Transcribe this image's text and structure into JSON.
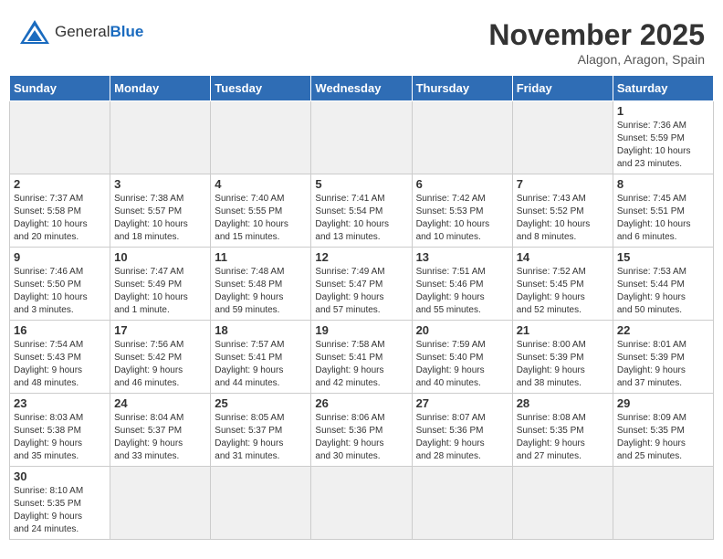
{
  "header": {
    "logo_general": "General",
    "logo_blue": "Blue",
    "month_title": "November 2025",
    "location": "Alagon, Aragon, Spain"
  },
  "weekdays": [
    "Sunday",
    "Monday",
    "Tuesday",
    "Wednesday",
    "Thursday",
    "Friday",
    "Saturday"
  ],
  "weeks": [
    [
      {
        "day": "",
        "info": ""
      },
      {
        "day": "",
        "info": ""
      },
      {
        "day": "",
        "info": ""
      },
      {
        "day": "",
        "info": ""
      },
      {
        "day": "",
        "info": ""
      },
      {
        "day": "",
        "info": ""
      },
      {
        "day": "1",
        "info": "Sunrise: 7:36 AM\nSunset: 5:59 PM\nDaylight: 10 hours\nand 23 minutes."
      }
    ],
    [
      {
        "day": "2",
        "info": "Sunrise: 7:37 AM\nSunset: 5:58 PM\nDaylight: 10 hours\nand 20 minutes."
      },
      {
        "day": "3",
        "info": "Sunrise: 7:38 AM\nSunset: 5:57 PM\nDaylight: 10 hours\nand 18 minutes."
      },
      {
        "day": "4",
        "info": "Sunrise: 7:40 AM\nSunset: 5:55 PM\nDaylight: 10 hours\nand 15 minutes."
      },
      {
        "day": "5",
        "info": "Sunrise: 7:41 AM\nSunset: 5:54 PM\nDaylight: 10 hours\nand 13 minutes."
      },
      {
        "day": "6",
        "info": "Sunrise: 7:42 AM\nSunset: 5:53 PM\nDaylight: 10 hours\nand 10 minutes."
      },
      {
        "day": "7",
        "info": "Sunrise: 7:43 AM\nSunset: 5:52 PM\nDaylight: 10 hours\nand 8 minutes."
      },
      {
        "day": "8",
        "info": "Sunrise: 7:45 AM\nSunset: 5:51 PM\nDaylight: 10 hours\nand 6 minutes."
      }
    ],
    [
      {
        "day": "9",
        "info": "Sunrise: 7:46 AM\nSunset: 5:50 PM\nDaylight: 10 hours\nand 3 minutes."
      },
      {
        "day": "10",
        "info": "Sunrise: 7:47 AM\nSunset: 5:49 PM\nDaylight: 10 hours\nand 1 minute."
      },
      {
        "day": "11",
        "info": "Sunrise: 7:48 AM\nSunset: 5:48 PM\nDaylight: 9 hours\nand 59 minutes."
      },
      {
        "day": "12",
        "info": "Sunrise: 7:49 AM\nSunset: 5:47 PM\nDaylight: 9 hours\nand 57 minutes."
      },
      {
        "day": "13",
        "info": "Sunrise: 7:51 AM\nSunset: 5:46 PM\nDaylight: 9 hours\nand 55 minutes."
      },
      {
        "day": "14",
        "info": "Sunrise: 7:52 AM\nSunset: 5:45 PM\nDaylight: 9 hours\nand 52 minutes."
      },
      {
        "day": "15",
        "info": "Sunrise: 7:53 AM\nSunset: 5:44 PM\nDaylight: 9 hours\nand 50 minutes."
      }
    ],
    [
      {
        "day": "16",
        "info": "Sunrise: 7:54 AM\nSunset: 5:43 PM\nDaylight: 9 hours\nand 48 minutes."
      },
      {
        "day": "17",
        "info": "Sunrise: 7:56 AM\nSunset: 5:42 PM\nDaylight: 9 hours\nand 46 minutes."
      },
      {
        "day": "18",
        "info": "Sunrise: 7:57 AM\nSunset: 5:41 PM\nDaylight: 9 hours\nand 44 minutes."
      },
      {
        "day": "19",
        "info": "Sunrise: 7:58 AM\nSunset: 5:41 PM\nDaylight: 9 hours\nand 42 minutes."
      },
      {
        "day": "20",
        "info": "Sunrise: 7:59 AM\nSunset: 5:40 PM\nDaylight: 9 hours\nand 40 minutes."
      },
      {
        "day": "21",
        "info": "Sunrise: 8:00 AM\nSunset: 5:39 PM\nDaylight: 9 hours\nand 38 minutes."
      },
      {
        "day": "22",
        "info": "Sunrise: 8:01 AM\nSunset: 5:39 PM\nDaylight: 9 hours\nand 37 minutes."
      }
    ],
    [
      {
        "day": "23",
        "info": "Sunrise: 8:03 AM\nSunset: 5:38 PM\nDaylight: 9 hours\nand 35 minutes."
      },
      {
        "day": "24",
        "info": "Sunrise: 8:04 AM\nSunset: 5:37 PM\nDaylight: 9 hours\nand 33 minutes."
      },
      {
        "day": "25",
        "info": "Sunrise: 8:05 AM\nSunset: 5:37 PM\nDaylight: 9 hours\nand 31 minutes."
      },
      {
        "day": "26",
        "info": "Sunrise: 8:06 AM\nSunset: 5:36 PM\nDaylight: 9 hours\nand 30 minutes."
      },
      {
        "day": "27",
        "info": "Sunrise: 8:07 AM\nSunset: 5:36 PM\nDaylight: 9 hours\nand 28 minutes."
      },
      {
        "day": "28",
        "info": "Sunrise: 8:08 AM\nSunset: 5:35 PM\nDaylight: 9 hours\nand 27 minutes."
      },
      {
        "day": "29",
        "info": "Sunrise: 8:09 AM\nSunset: 5:35 PM\nDaylight: 9 hours\nand 25 minutes."
      }
    ],
    [
      {
        "day": "30",
        "info": "Sunrise: 8:10 AM\nSunset: 5:35 PM\nDaylight: 9 hours\nand 24 minutes."
      },
      {
        "day": "",
        "info": ""
      },
      {
        "day": "",
        "info": ""
      },
      {
        "day": "",
        "info": ""
      },
      {
        "day": "",
        "info": ""
      },
      {
        "day": "",
        "info": ""
      },
      {
        "day": "",
        "info": ""
      }
    ]
  ]
}
